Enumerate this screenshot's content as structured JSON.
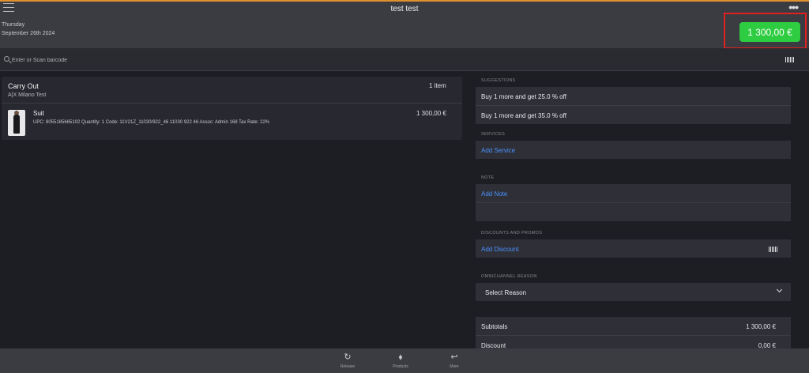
{
  "header": {
    "title": "test test",
    "day": "Thursday",
    "date": "September 26th 2024",
    "total": "1 300,00 €"
  },
  "search": {
    "placeholder": "Enter or Scan barcode"
  },
  "cart": {
    "type": "Carry Out",
    "store": "A|X Milano Test",
    "item_count": "1 item",
    "items": [
      {
        "name": "Suit",
        "details": "UPC: 8055185665102 Quantity: 1 Code: 11V21Z_11030/922_46 11030 922 46 Assoc: Admin 168 Tax Rate: 22%",
        "price": "1 300,00 €"
      }
    ]
  },
  "panel": {
    "suggestions_label": "SUGGESTIONS",
    "suggestions": [
      "Buy 1 more and get 25.0 % off",
      "Buy 1 more and get 35.0 % off"
    ],
    "services_label": "SERVICES",
    "add_service": "Add Service",
    "note_label": "NOTE",
    "add_note": "Add Note",
    "discounts_label": "DISCOUNTS AND PROMOS",
    "add_discount": "Add Discount",
    "omni_label": "OMNICHANNEL REASON",
    "select_reason": "Select Reason",
    "subtotals_label": "Subtotals",
    "subtotals_value": "1 300,00 €",
    "discount_label": "Discount",
    "discount_value": "0,00 €"
  },
  "tabs": [
    {
      "label": "Release",
      "icon": "refresh-icon"
    },
    {
      "label": "Products",
      "icon": "tags-icon"
    },
    {
      "label": "More",
      "icon": "reply-icon"
    }
  ],
  "colors": {
    "accent_green": "#2ecc40",
    "link_blue": "#4a90ff",
    "highlight_red": "#e2201f",
    "top_orange": "#e0902e"
  }
}
